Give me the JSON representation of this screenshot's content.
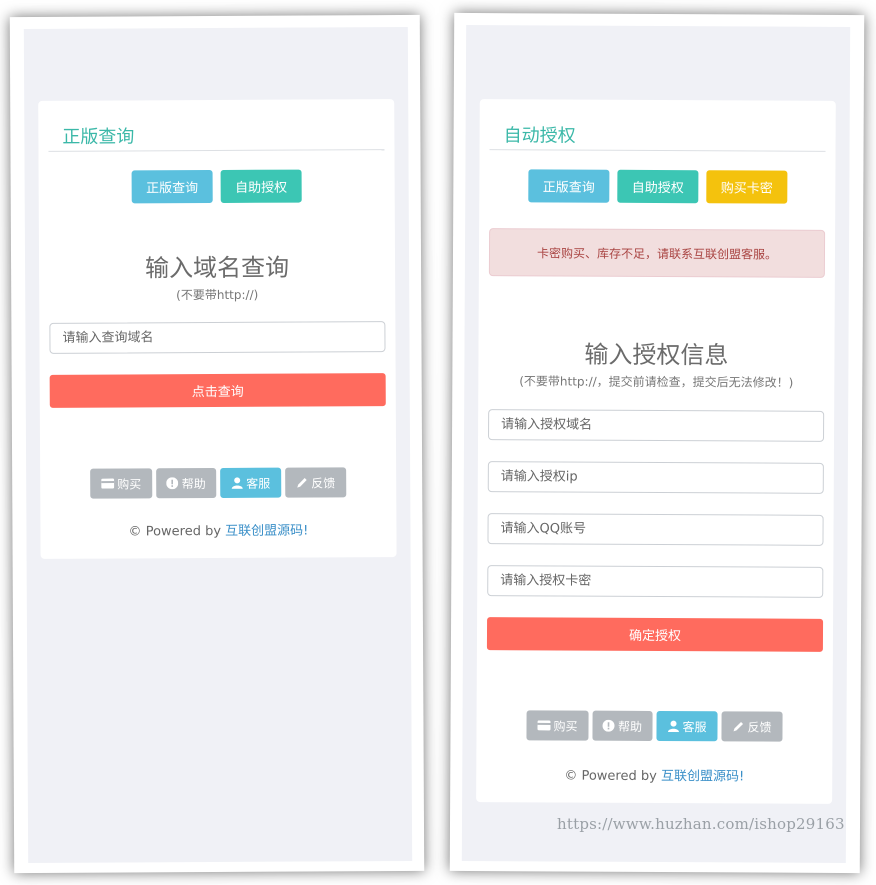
{
  "left_panel": {
    "title": "正版查询",
    "tabs": [
      "正版查询",
      "自助授权"
    ],
    "heading": "输入域名查询",
    "subheading": "(不要带http://)",
    "domain_input_placeholder": "请输入查询域名",
    "submit_label": "点击查询",
    "footer_buttons": [
      {
        "label": "购买",
        "icon": "credit-card-icon"
      },
      {
        "label": "帮助",
        "icon": "exclamation-circle-icon"
      },
      {
        "label": "客服",
        "icon": "user-icon"
      },
      {
        "label": "反馈",
        "icon": "pencil-icon"
      }
    ],
    "powered_prefix": "© Powered by ",
    "powered_link": "互联创盟源码!"
  },
  "right_panel": {
    "title": "自动授权",
    "tabs": [
      "正版查询",
      "自助授权",
      "购买卡密"
    ],
    "alert_text": "卡密购买、库存不足，请联系互联创盟客服。",
    "heading": "输入授权信息",
    "subheading": "(不要带http://，提交前请检查，提交后无法修改！)",
    "inputs": [
      "请输入授权域名",
      "请输入授权ip",
      "请输入QQ账号",
      "请输入授权卡密"
    ],
    "submit_label": "确定授权",
    "footer_buttons": [
      {
        "label": "购买",
        "icon": "credit-card-icon"
      },
      {
        "label": "帮助",
        "icon": "exclamation-circle-icon"
      },
      {
        "label": "客服",
        "icon": "user-icon"
      },
      {
        "label": "反馈",
        "icon": "pencil-icon"
      }
    ],
    "powered_prefix": "© Powered by ",
    "powered_link": "互联创盟源码!"
  },
  "watermark": "https://www.huzhan.com/ishop29163",
  "colors": {
    "accent_title": "#3bb8a8",
    "btn_info": "#5bc0de",
    "btn_teal": "#3cc6b4",
    "btn_yellow": "#f4c20d",
    "submit": "#ff6b5e",
    "alert_bg": "#f2dede",
    "alert_text": "#a94442"
  }
}
